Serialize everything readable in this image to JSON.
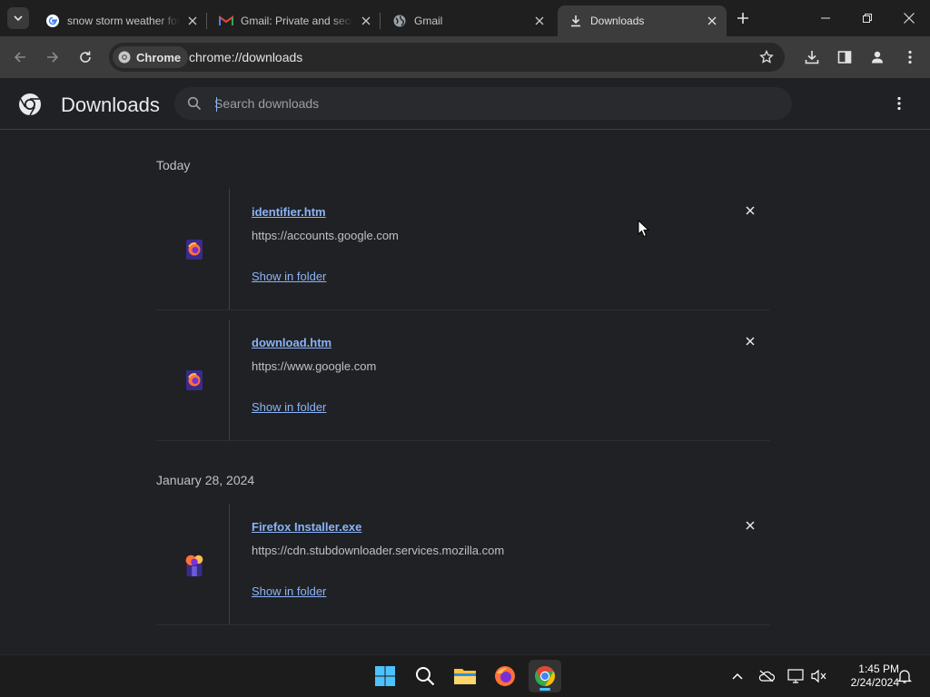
{
  "tabs": [
    {
      "title": "snow storm weather forecast - Google Search",
      "favicon": "google-g-icon"
    },
    {
      "title": "Gmail: Private and secure email",
      "favicon": "gmail-icon"
    },
    {
      "title": "Gmail",
      "favicon": "globe-icon"
    },
    {
      "title": "Downloads",
      "favicon": "download-icon",
      "active": true
    }
  ],
  "toolbar": {
    "chip_label": "Chrome",
    "url": "chrome://downloads"
  },
  "page": {
    "title": "Downloads",
    "search_placeholder": "Search downloads"
  },
  "downloads": {
    "groups": [
      {
        "date": "Today",
        "items": [
          {
            "file": "identifier.htm",
            "url": "https://accounts.google.com",
            "action": "Show in folder",
            "icon": "firefox-file-icon"
          },
          {
            "file": "download.htm",
            "url": "https://www.google.com",
            "action": "Show in folder",
            "icon": "firefox-file-icon"
          }
        ]
      },
      {
        "date": "January 28, 2024",
        "items": [
          {
            "file": "Firefox Installer.exe",
            "url": "https://cdn.stubdownloader.services.mozilla.com",
            "action": "Show in folder",
            "icon": "firefox-installer-icon"
          }
        ]
      }
    ]
  },
  "taskbar": {
    "time": "1:45 PM",
    "date": "2/24/2024",
    "apps": [
      "windows-start-icon",
      "search-icon",
      "file-explorer-icon",
      "firefox-icon",
      "chrome-icon"
    ]
  },
  "colors": {
    "accent": "#8ab4f8",
    "background": "#202124",
    "toolbar": "#3c3c3c"
  }
}
